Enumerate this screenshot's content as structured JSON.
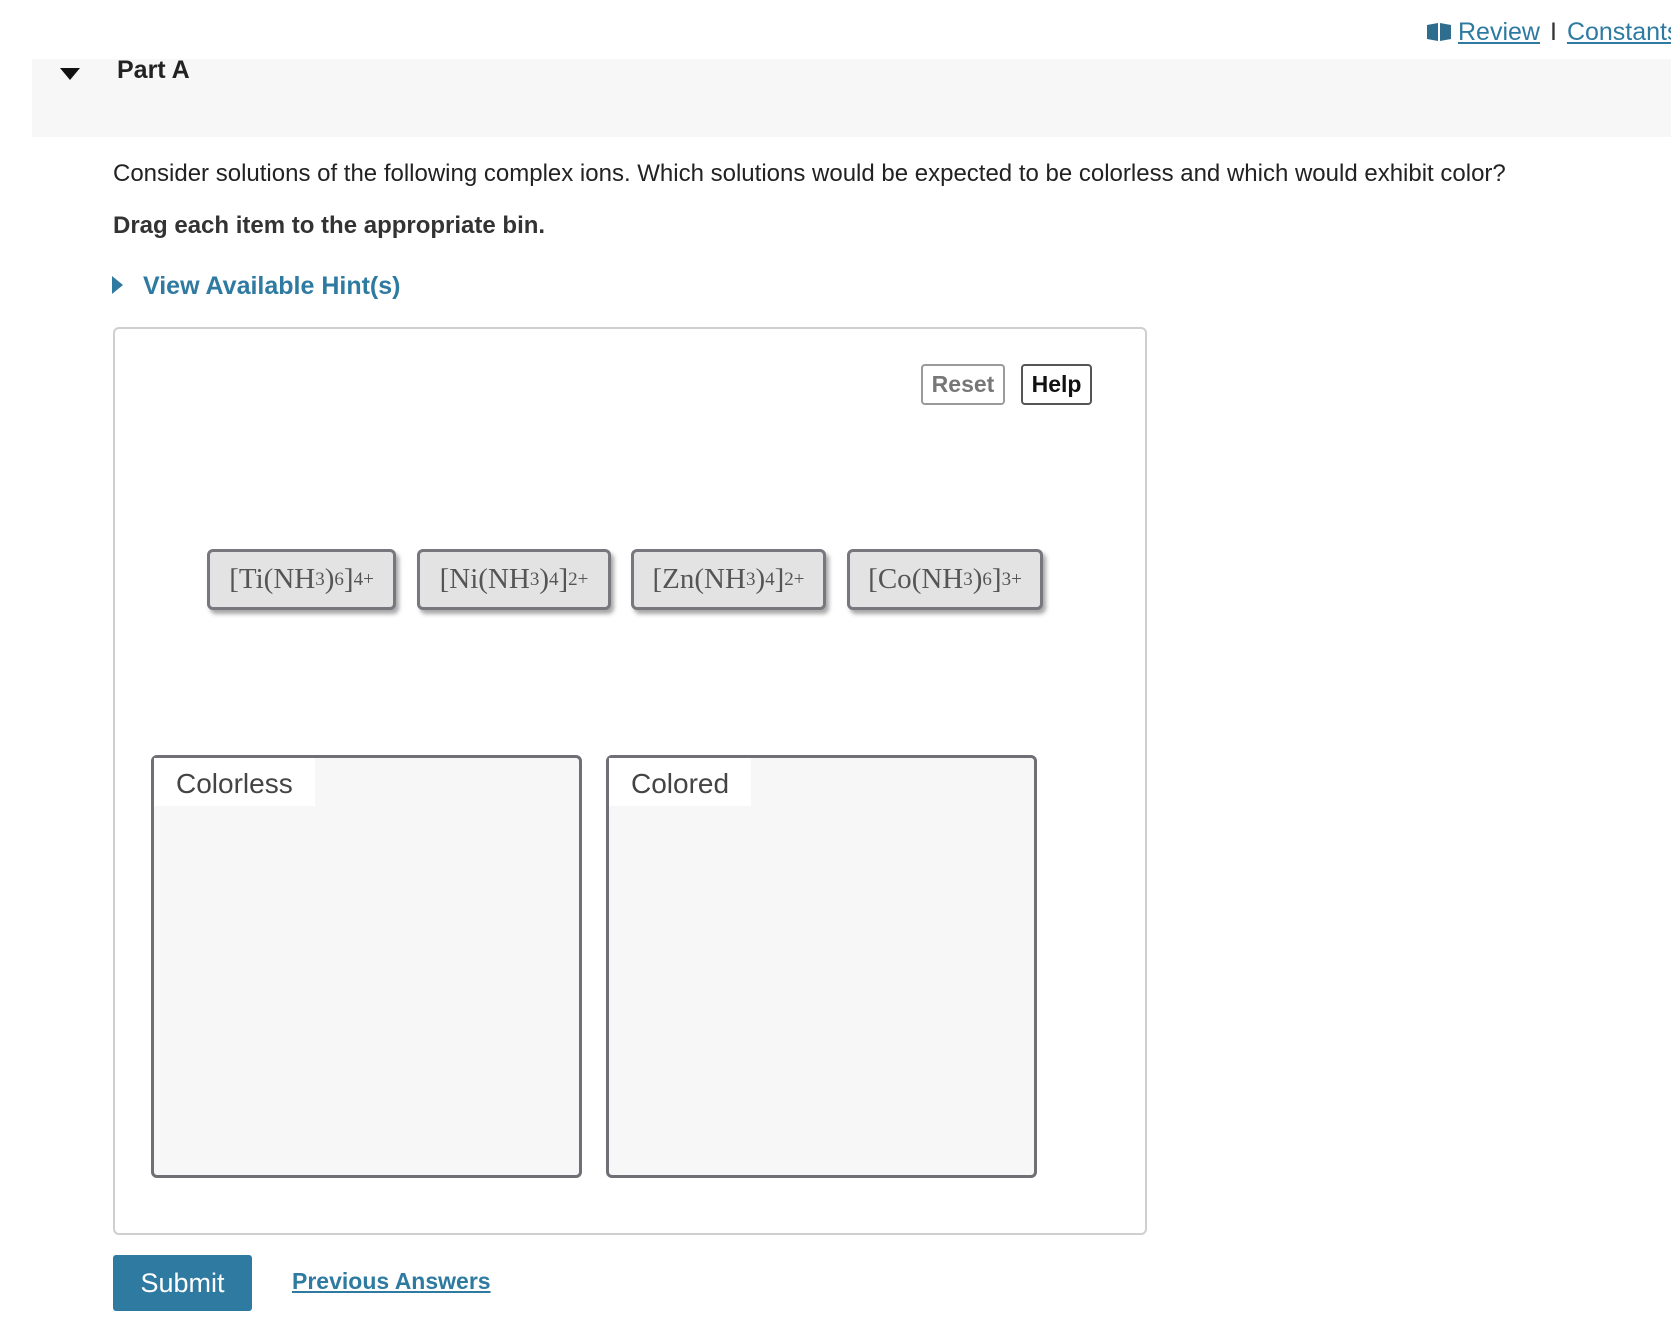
{
  "top_links": {
    "review": "Review",
    "separator": "I",
    "constants": "Constants"
  },
  "part": {
    "title": "Part A"
  },
  "question": {
    "text": "Consider solutions of the following complex ions. Which solutions would be expected to be colorless and which would exhibit color?",
    "instruction": "Drag each item to the appropriate bin."
  },
  "hint": {
    "label": "View Available Hint(s)"
  },
  "toolbar": {
    "reset": "Reset",
    "help": "Help"
  },
  "items": [
    {
      "metal": "Ti",
      "ligand": "NH",
      "ligand_sub": "3",
      "count": "6",
      "charge": "4+"
    },
    {
      "metal": "Ni",
      "ligand": "NH",
      "ligand_sub": "3",
      "count": "4",
      "charge": "2+"
    },
    {
      "metal": "Zn",
      "ligand": "NH",
      "ligand_sub": "3",
      "count": "4",
      "charge": "2+"
    },
    {
      "metal": "Co",
      "ligand": "NH",
      "ligand_sub": "3",
      "count": "6",
      "charge": "3+"
    }
  ],
  "bins": [
    {
      "label": "Colorless"
    },
    {
      "label": "Colored"
    }
  ],
  "actions": {
    "submit": "Submit",
    "previous_answers": "Previous Answers"
  },
  "colors": {
    "accent": "#2e7aa0",
    "tile_bg": "#e3e3e3",
    "bin_bg": "#f7f7f7"
  }
}
